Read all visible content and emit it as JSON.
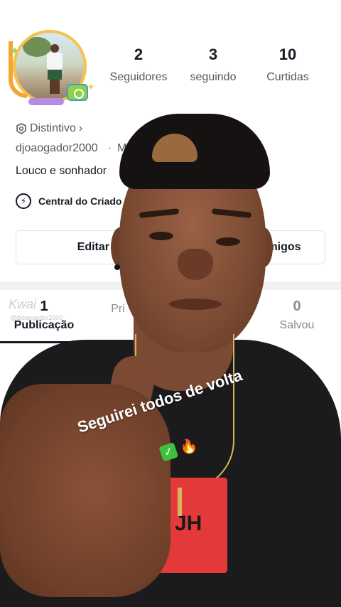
{
  "profile": {
    "stats": [
      {
        "count": "2",
        "label": "Seguidores"
      },
      {
        "count": "3",
        "label": "seguindo"
      },
      {
        "count": "10",
        "label": "Curtidas"
      }
    ],
    "badge_label": "Distintivo",
    "badge_chevron": "›",
    "username": "djoaogador2000",
    "username_extra": "M",
    "bio": "Louco e sonhador",
    "creator_center": "Central do Criado",
    "edit_button": "Editar per",
    "friends_button": "migos"
  },
  "tabs": [
    {
      "count": "1",
      "label": "Publicação",
      "active": true
    },
    {
      "count": "",
      "label": "Pri",
      "active": false
    },
    {
      "count": "0",
      "label": "Salvou",
      "active": false
    }
  ],
  "watermark": {
    "brand": "Kwai",
    "handle": "@djoaogador2000"
  },
  "overlay": {
    "caption": "Seguirei todos de volta",
    "check_glyph": "✓",
    "fire_glyph": "🔥",
    "shirt_print": "JH"
  },
  "icons": [
    "badge-icon",
    "bolt-icon",
    "chevron-right-icon"
  ]
}
